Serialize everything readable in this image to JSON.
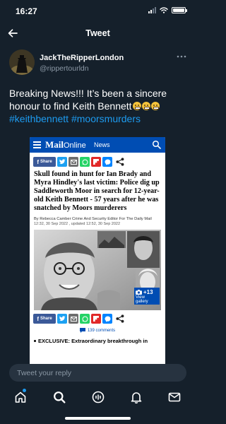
{
  "status_bar": {
    "time": "16:27"
  },
  "nav": {
    "title": "Tweet"
  },
  "tweet": {
    "author_name": "JackTheRipperLondon",
    "author_handle": "@rippertourldn",
    "text": "Breaking News!!! It’s been a sincere honour to find Keith Bennett",
    "hashtags": [
      "#keithbennett",
      "#moorsmurders"
    ]
  },
  "embed": {
    "logo_main": "Mail",
    "logo_sub": "Online",
    "section": "News",
    "share_label": "Share",
    "headline": "Skull found in hunt for Ian Brady and Myra Hindley's last victim: Police dig up Saddleworth Moor in search for 12-year-old Keith Bennett - 57 years after he was snatched by Moors murderers",
    "byline": "By Rebecca Camber Crime And Security Editor For The Daily Mail",
    "date": "12:32, 30 Sep 2022 , updated 12:52, 30 Sep 2022",
    "gallery_count": "+13",
    "gallery_label": "View gallery",
    "comments": "139 comments",
    "exclusive": "EXCLUSIVE:  Extraordinary breakthrough in"
  },
  "reply": {
    "placeholder": "Tweet your reply"
  },
  "colors": {
    "background": "#15202b",
    "accent": "#1d9bf0",
    "dailymail_blue": "#004db3"
  },
  "icons": {
    "back": "arrow-left-icon",
    "more": "more-horizontal-icon",
    "tabs": [
      "home-icon",
      "search-icon",
      "spaces-icon",
      "notifications-icon",
      "messages-icon"
    ]
  }
}
